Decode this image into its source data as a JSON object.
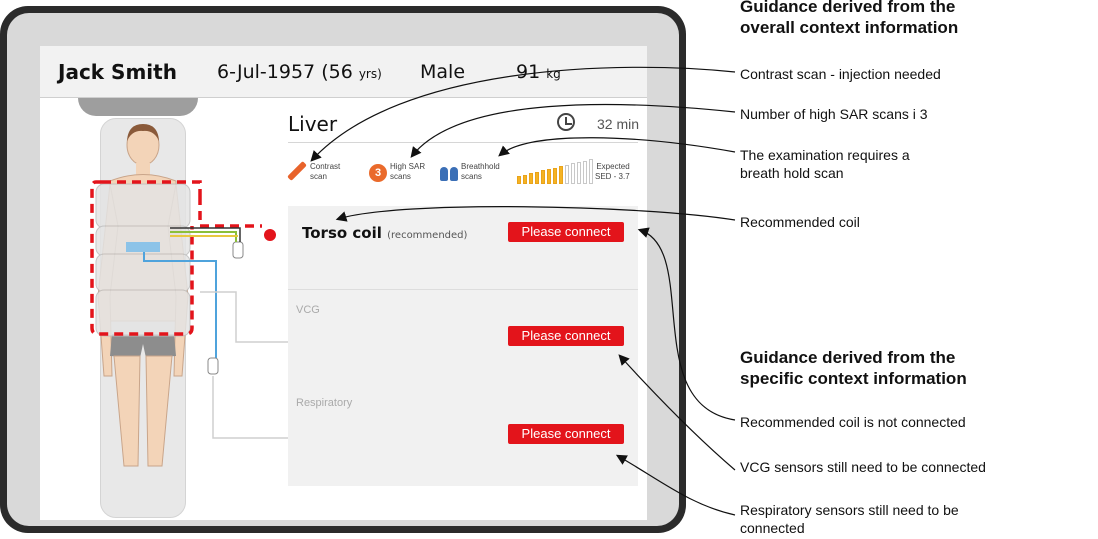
{
  "patient": {
    "name": "Jack Smith",
    "dob": "6-Jul-1957",
    "age": "(56",
    "age_unit": "yrs)",
    "sex": "Male",
    "weight": "91",
    "weight_unit": "kg"
  },
  "exam": {
    "title": "Liver",
    "duration": "32 min"
  },
  "indicators": {
    "contrast_line1": "Contrast",
    "contrast_line2": "scan",
    "sar_count": "3",
    "sar_line1": "High SAR",
    "sar_line2": "scans",
    "breathhold_line1": "Breathhold",
    "breathhold_line2": "scans",
    "sed_line1": "Expected",
    "sed_line2": "SED - 3.7",
    "sed_level": 0.6
  },
  "coils": {
    "torso_name": "Torso coil",
    "torso_note": "(recommended)",
    "vcg_label": "VCG",
    "resp_label": "Respiratory",
    "connect_label": "Please connect"
  },
  "guidance": {
    "overall_heading_line1": "Guidance derived from the",
    "overall_heading_line2": "overall context information",
    "item_contrast": "Contrast scan - injection needed",
    "item_sar": "Number of high SAR scans i 3",
    "item_breath_line1": "The examination requires a",
    "item_breath_line2": "breath hold scan",
    "item_coil": "Recommended coil",
    "specific_heading_line1": "Guidance derived from the",
    "specific_heading_line2": "specific context information",
    "item_coil_not_connected": "Recommended coil is not connected",
    "item_vcg": "VCG sensors still need to be connected",
    "item_resp_line1": "Respiratory sensors still need to be",
    "item_resp_line2": "connected"
  },
  "colors": {
    "accent_red": "#e3141b",
    "sar_orange": "#ea6a2b",
    "lung_blue": "#3b6fb6",
    "sed_yellow": "#f5b323"
  }
}
